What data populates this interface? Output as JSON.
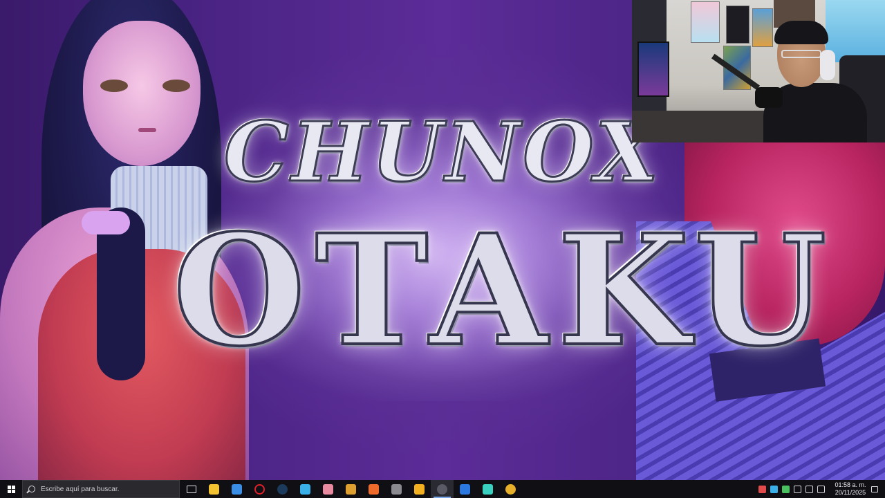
{
  "wallpaper": {
    "logo_line1": "CHUNOX",
    "logo_line2": "OTAKU"
  },
  "taskbar": {
    "search_placeholder": "Escribe aquí para buscar.",
    "pinned": [
      {
        "name": "file-explorer",
        "icon": "folder-icon",
        "color": "#f2c230"
      },
      {
        "name": "microsoft-store",
        "icon": "store-icon",
        "color": "#3a8ee6"
      },
      {
        "name": "opera",
        "icon": "opera-icon",
        "color": "#e0202a"
      },
      {
        "name": "steam",
        "icon": "steam-icon",
        "color": "#1b3a5c"
      },
      {
        "name": "app-blue",
        "icon": "app-icon",
        "color": "#3ab0e8"
      },
      {
        "name": "app-anime",
        "icon": "app-icon",
        "color": "#e88aa0"
      },
      {
        "name": "app-gold",
        "icon": "app-icon",
        "color": "#e0a030"
      },
      {
        "name": "app-orange",
        "icon": "app-icon",
        "color": "#f06a2a"
      },
      {
        "name": "app-gray",
        "icon": "app-icon",
        "color": "#8a8a90"
      },
      {
        "name": "rockstar",
        "icon": "rockstar-icon",
        "color": "#f2b020"
      },
      {
        "name": "obs",
        "icon": "obs-icon",
        "color": "#5a5a66",
        "active": true
      },
      {
        "name": "app-blue2",
        "icon": "app-icon",
        "color": "#2a78e0"
      },
      {
        "name": "app-teal",
        "icon": "app-icon",
        "color": "#3ad0c0"
      },
      {
        "name": "chrome",
        "icon": "chrome-icon",
        "color": "#e8b02a"
      }
    ],
    "tray_colors": [
      "#e04a4a",
      "#3ab0e8",
      "#4ac060",
      "#dcdce0",
      "#dcdce0",
      "#dcdce0"
    ],
    "clock_time": "01:58 a. m.",
    "clock_date": "20/11/2025"
  }
}
